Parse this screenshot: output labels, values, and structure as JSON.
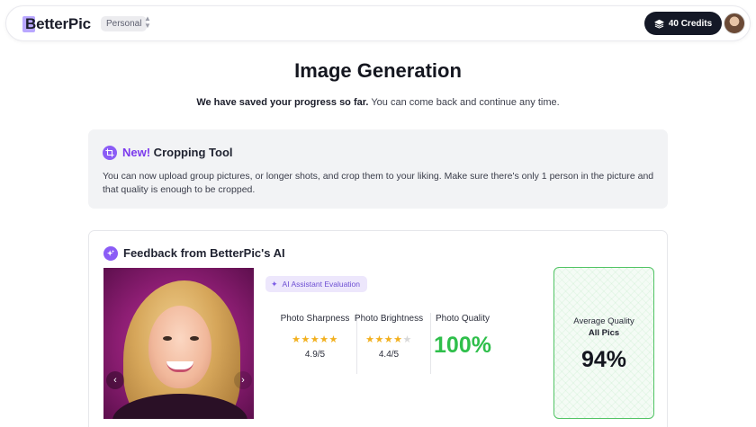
{
  "header": {
    "brand": "BetterPic",
    "workspace": "Personal",
    "credits_label": "40 Credits",
    "icons": {
      "workspace_switch": "chevron-up-down-icon",
      "credits": "layers-icon"
    }
  },
  "page": {
    "title": "Image Generation",
    "subtitle_bold": "We have saved your progress so far.",
    "subtitle_rest": " You can come back and continue any time."
  },
  "crop_notice": {
    "new_label": "New!",
    "title": " Cropping Tool",
    "description": "You can now upload group pictures, or longer shots, and crop them to your liking. Make sure there's only 1 person in the picture and that quality is enough to be cropped.",
    "icon": "crop-icon",
    "accent": "#8b5cf6"
  },
  "feedback": {
    "title": "Feedback from BetterPic's AI",
    "badge": "AI Assistant Evaluation",
    "metrics": [
      {
        "label": "Photo Sharpness",
        "stars": 5,
        "value": "4.9/5"
      },
      {
        "label": "Photo Brightness",
        "stars": 4.5,
        "value": "4.4/5"
      },
      {
        "label": "Photo Quality",
        "value": "100%"
      }
    ],
    "average": {
      "label": "Average Quality",
      "sub": "All Pics",
      "value": "94%"
    },
    "colors": {
      "quality_green": "#2fbf4b",
      "star": "#f2b01e",
      "card_border": "#52c465"
    }
  }
}
